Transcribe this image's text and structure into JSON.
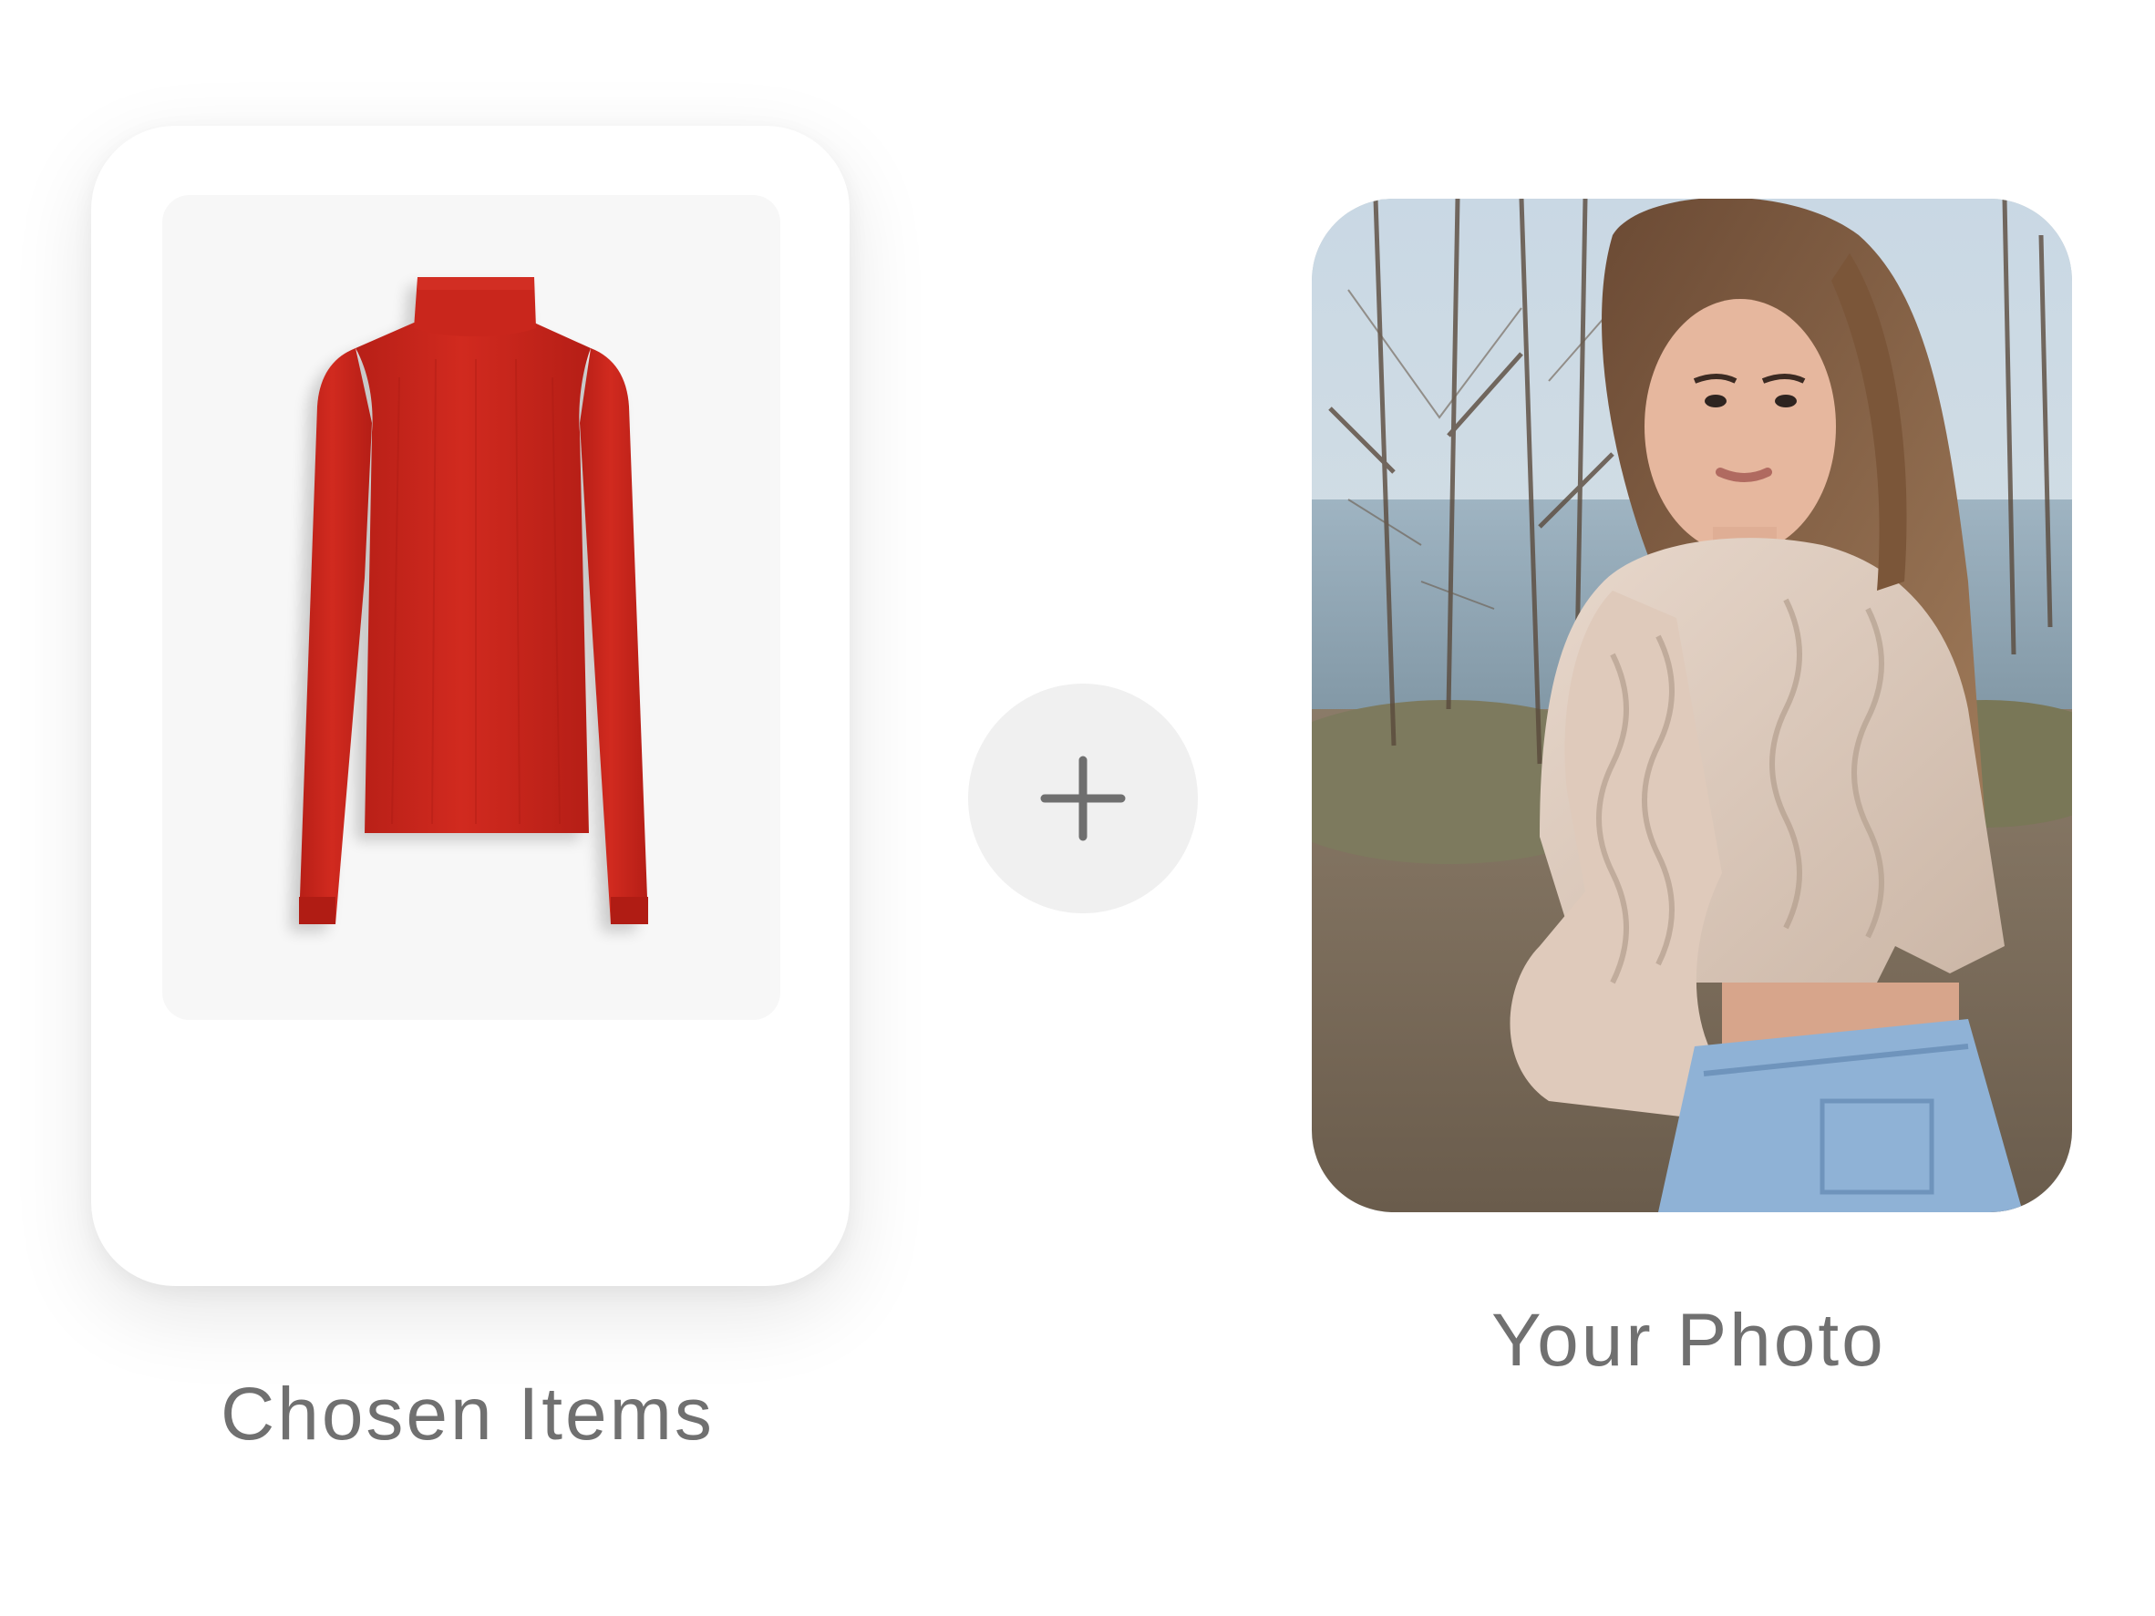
{
  "chosen_items": {
    "label": "Chosen Items",
    "items": [
      {
        "name": "red turtleneck sweater",
        "color": "#c7251c"
      }
    ]
  },
  "add_action": {
    "icon": "plus-icon"
  },
  "your_photo": {
    "label": "Your Photo",
    "description_icon": "person-photo"
  },
  "colors": {
    "label_text": "#707070",
    "card_background": "#ffffff",
    "thumb_background": "#f7f7f7",
    "plus_background": "#f0f0f0",
    "plus_icon": "#6f6f6f"
  }
}
